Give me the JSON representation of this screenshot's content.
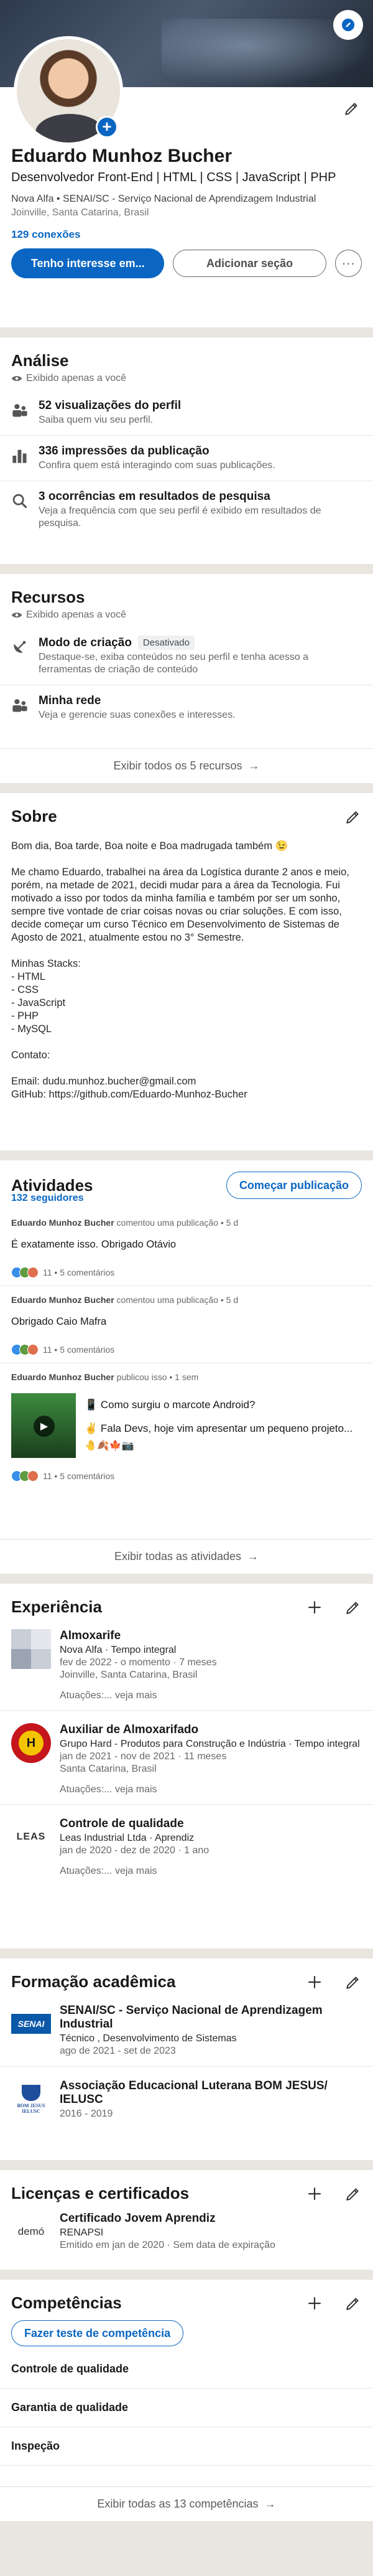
{
  "profile": {
    "name": "Eduardo Munhoz Bucher",
    "headline": "Desenvolvedor Front-End | HTML | CSS | JavaScript | PHP",
    "org": "Nova Alfa • SENAI/SC - Serviço Nacional de Aprendizagem Industrial",
    "location": "Joinville, Santa Catarina, Brasil",
    "connections": "129 conexões",
    "primary_button": "Tenho interesse em...",
    "secondary_button": "Adicionar seção",
    "more_button": "···"
  },
  "analytics": {
    "title": "Análise",
    "visibility": "Exibido apenas a você",
    "items": [
      {
        "title": "52 visualizações do perfil",
        "desc": "Saiba quem viu seu perfil."
      },
      {
        "title": "336 impressões da publicação",
        "desc": "Confira quem está interagindo com suas publicações."
      },
      {
        "title": "3 ocorrências em resultados de pesquisa",
        "desc": "Veja a frequência com que seu perfil é exibido em resultados de pesquisa."
      }
    ]
  },
  "resources": {
    "title": "Recursos",
    "visibility": "Exibido apenas a você",
    "items": [
      {
        "title": "Modo de criação",
        "badge": "Desativado",
        "desc": "Destaque-se, exiba conteúdos no seu perfil e tenha acesso a ferramentas de criação de conteúdo"
      },
      {
        "title": "Minha rede",
        "badge": "",
        "desc": "Veja e gerencie suas conexões e interesses."
      }
    ],
    "footer": "Exibir todos os 5 recursos"
  },
  "about": {
    "title": "Sobre",
    "text": "Bom dia, Boa tarde, Boa noite e Boa madrugada também 😉\n\nMe chamo Eduardo, trabalhei na área da Logística durante 2 anos e meio, porém, na metade de 2021, decidi mudar para a área da Tecnologia. Fui motivado a isso por todos da minha família e também por ser um sonho, sempre tive vontade de criar coisas novas ou criar soluções. E com isso, decide começar um curso Técnico em Desenvolvimento de Sistemas de Agosto de 2021, atualmente estou no 3° Semestre.\n\nMinhas Stacks:\n- HTML\n- CSS\n- JavaScript\n- PHP\n- MySQL\n\nContato:\n\nEmail: dudu.munhoz.bucher@gmail.com\nGitHub: https://github.com/Eduardo-Munhoz-Bucher"
  },
  "activity": {
    "title": "Atividades",
    "followers": "132 seguidores",
    "start_post": "Começar publicação",
    "posts": [
      {
        "author": "Eduardo Munhoz Bucher",
        "meta": " comentou uma publicação • 5 d",
        "text": "É exatamente isso. Obrigado Otávio",
        "stats": "11 • 5 comentários"
      },
      {
        "author": "Eduardo Munhoz Bucher",
        "meta": " comentou uma publicação • 5 d",
        "text": "Obrigado Caio Mafra",
        "stats": "11 • 5 comentários"
      },
      {
        "author": "Eduardo Munhoz Bucher",
        "meta": " publicou isso • 1 sem",
        "line1": "📱 Como surgiu o marcote Android?",
        "line2": "✌️ Fala Devs, hoje vim apresentar um pequeno projeto...",
        "emoji_row": "🤚🍂🍁📷",
        "stats": "11 • 5 comentários"
      }
    ],
    "footer": "Exibir todas as atividades"
  },
  "experience": {
    "title": "Experiência",
    "items": [
      {
        "title": "Almoxarife",
        "company": "Nova Alfa · Tempo integral",
        "dates": "fev de 2022 - o momento · 7 meses",
        "location": "Joinville, Santa Catarina, Brasil",
        "skills_label": "Atuações:",
        "skills_more": "... veja mais"
      },
      {
        "title": "Auxiliar de Almoxarifado",
        "company": "Grupo Hard - Produtos para Construção e Indústria · Tempo integral",
        "dates": "jan de 2021 - nov de 2021 · 11 meses",
        "location": "Santa Catarina, Brasil",
        "skills_label": "Atuações:",
        "skills_more": "... veja mais"
      },
      {
        "title": "Controle de qualidade",
        "company": "Leas Industrial Ltda · Aprendiz",
        "dates": "jan de 2020 - dez de 2020 · 1 ano",
        "location": "",
        "skills_label": "Atuações:",
        "skills_more": "... veja mais",
        "logo_text": "LEAS"
      }
    ]
  },
  "education": {
    "title": "Formação acadêmica",
    "items": [
      {
        "title": "SENAI/SC - Serviço Nacional de Aprendizagem Industrial",
        "degree": "Técnico , Desenvolvimento de Sistemas",
        "dates": "ago de 2021 - set de 2023",
        "logo_text": "SENAI"
      },
      {
        "title": "Associação Educacional Luterana BOM JESUS/ IELUSC",
        "degree": "",
        "dates": "2016 - 2019",
        "logo_text": "BOM JESUS IELUSC"
      }
    ]
  },
  "licenses": {
    "title": "Licenças e certificados",
    "items": [
      {
        "title": "Certificado Jovem Aprendiz",
        "issuer": "RENAPSI",
        "dates": "Emitido em jan de 2020 · Sem data de expiração",
        "logo_text": "demó"
      }
    ]
  },
  "skills": {
    "title": "Competências",
    "test_button": "Fazer teste de competência",
    "items": [
      "Controle de qualidade",
      "Garantia de qualidade",
      "Inspeção"
    ],
    "footer": "Exibir todas as 13 competências"
  },
  "colors": {
    "accent": "#0a66c2",
    "background": "#e9e5df"
  }
}
